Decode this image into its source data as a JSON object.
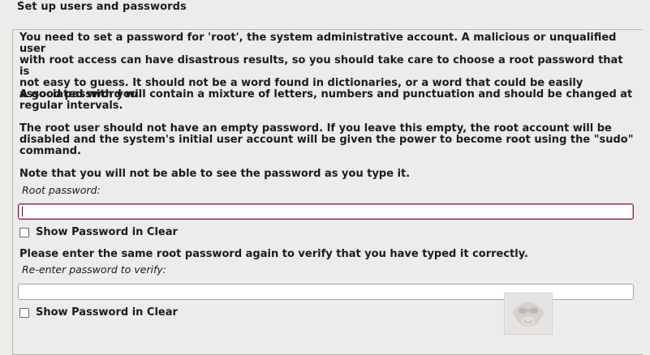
{
  "header": {
    "title": "Set up users and passwords"
  },
  "content": {
    "intro": "You need to set a password for 'root', the system administrative account. A malicious or unqualified user\nwith root access can have disastrous results, so you should take care to choose a root password that is\nnot easy to guess. It should not be a word found in dictionaries, or a word that could be easily\nassociated with you.",
    "mixture": "A good password will contain a mixture of letters, numbers and punctuation and should be changed at\nregular intervals.",
    "empty_warning": "The root user should not have an empty password. If you leave this empty, the root account will be\ndisabled and the system's initial user account will be given the power to become root using the \"sudo\"\ncommand.",
    "note": "Note that you will not be able to see the password as you type it.",
    "verify_prompt": "Please enter the same root password again to verify that you have typed it correctly."
  },
  "root_password": {
    "label": "Root password:",
    "value": "",
    "show_clear_label": "Show Password in Clear"
  },
  "verify_password": {
    "label": "Re-enter password to verify:",
    "value": "",
    "show_clear_label": "Show Password in Clear"
  },
  "colors": {
    "background": "#edeceb",
    "focus_border": "#8b1d3b"
  }
}
